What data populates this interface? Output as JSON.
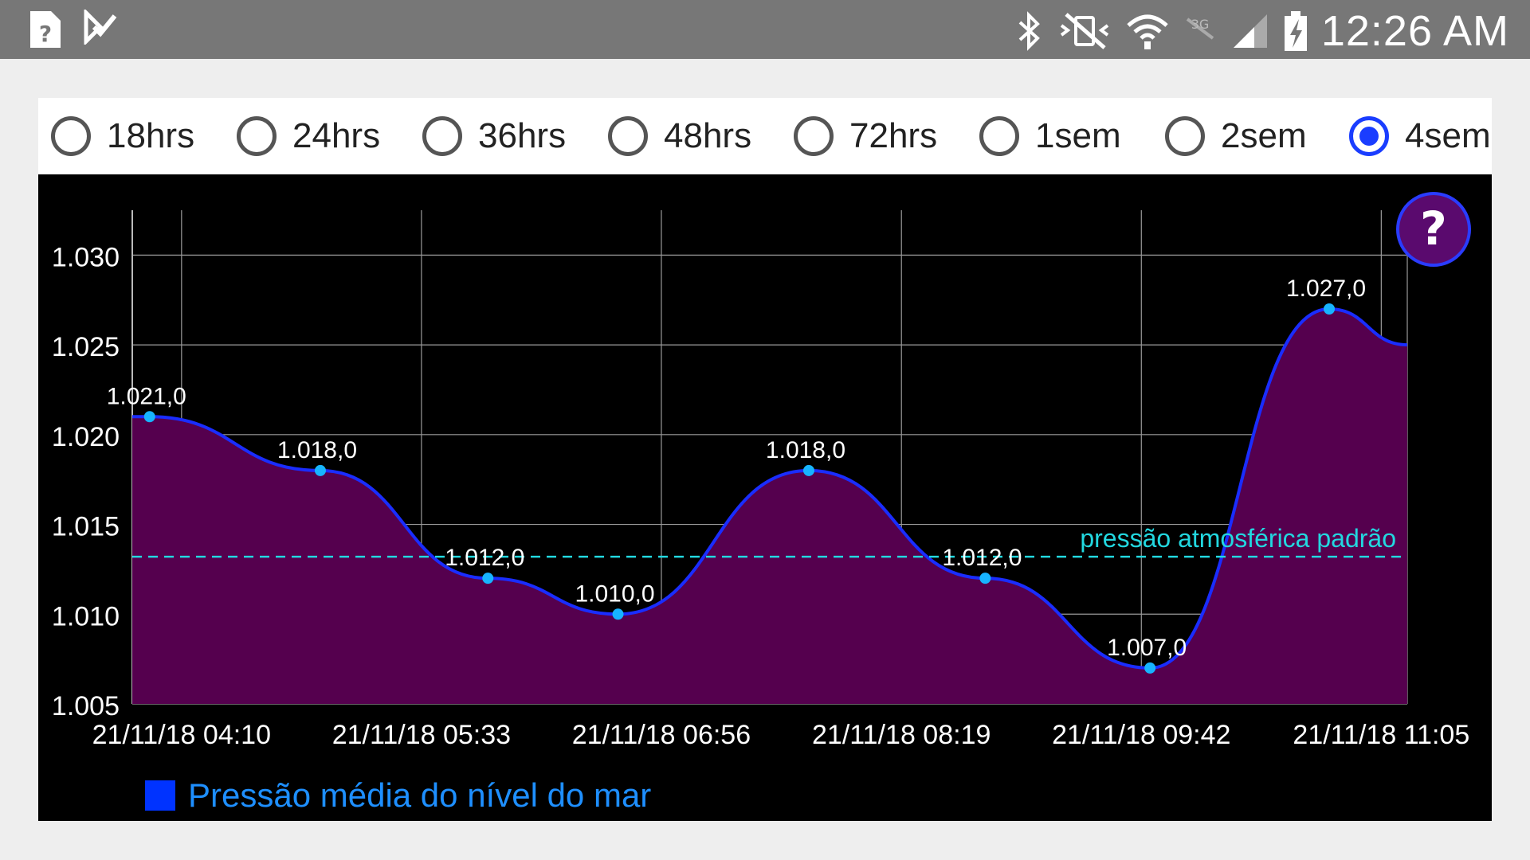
{
  "status_bar": {
    "time": "12:26 AM",
    "icons_left": [
      "help-file-icon",
      "task-check-icon"
    ],
    "icons_right": [
      "bluetooth-icon",
      "vibrate-mute-icon",
      "wifi-icon",
      "no-data-icon",
      "signal-icon",
      "battery-charging-icon"
    ]
  },
  "range_selector": {
    "options": [
      {
        "label": "18hrs",
        "checked": false
      },
      {
        "label": "24hrs",
        "checked": false
      },
      {
        "label": "36hrs",
        "checked": false
      },
      {
        "label": "48hrs",
        "checked": false
      },
      {
        "label": "72hrs",
        "checked": false
      },
      {
        "label": "1sem",
        "checked": false
      },
      {
        "label": "2sem",
        "checked": false
      },
      {
        "label": "4sem",
        "checked": true
      }
    ]
  },
  "help_button": {
    "label": "?"
  },
  "colors": {
    "line": "#1a2dff",
    "fill": "#55004e",
    "point": "#17b4ff",
    "reference": "#22d8e0",
    "legend_swatch": "#0033ff",
    "legend_text": "#1e8fff",
    "grid": "#9a9a9a"
  },
  "chart_data": {
    "type": "area",
    "x_ticks": [
      "21/11/18 04:10",
      "21/11/18 05:33",
      "21/11/18 06:56",
      "21/11/18 08:19",
      "21/11/18 09:42",
      "21/11/18 11:05"
    ],
    "y_ticks": [
      "1.005",
      "1.010",
      "1.015",
      "1.020",
      "1.025",
      "1.030"
    ],
    "y_tick_values": [
      1.005,
      1.01,
      1.015,
      1.02,
      1.025,
      1.03
    ],
    "ylim": [
      1.005,
      1.0325
    ],
    "xlim": [
      3.883,
      11.233
    ],
    "x_tick_values": [
      4.167,
      5.55,
      6.933,
      8.317,
      9.7,
      11.083
    ],
    "grid": true,
    "legend_position": "bottom-left",
    "series": [
      {
        "name": "Pressão média do nível do mar",
        "x": [
          3.883,
          3.983,
          4.967,
          5.933,
          6.683,
          7.783,
          8.8,
          9.75,
          10.783,
          11.233
        ],
        "values": [
          1.021,
          1.021,
          1.018,
          1.012,
          1.01,
          1.018,
          1.012,
          1.007,
          1.027,
          1.025
        ],
        "point_flags": [
          false,
          true,
          true,
          true,
          true,
          true,
          true,
          true,
          true,
          false
        ],
        "data_labels": [
          "",
          "1.021,0",
          "1.018,0",
          "1.012,0",
          "1.010,0",
          "1.018,0",
          "1.012,0",
          "1.007,0",
          "1.027,0",
          ""
        ]
      }
    ],
    "reference_line": {
      "value": 1.0132,
      "label": "pressão atmosférica padrão"
    }
  }
}
